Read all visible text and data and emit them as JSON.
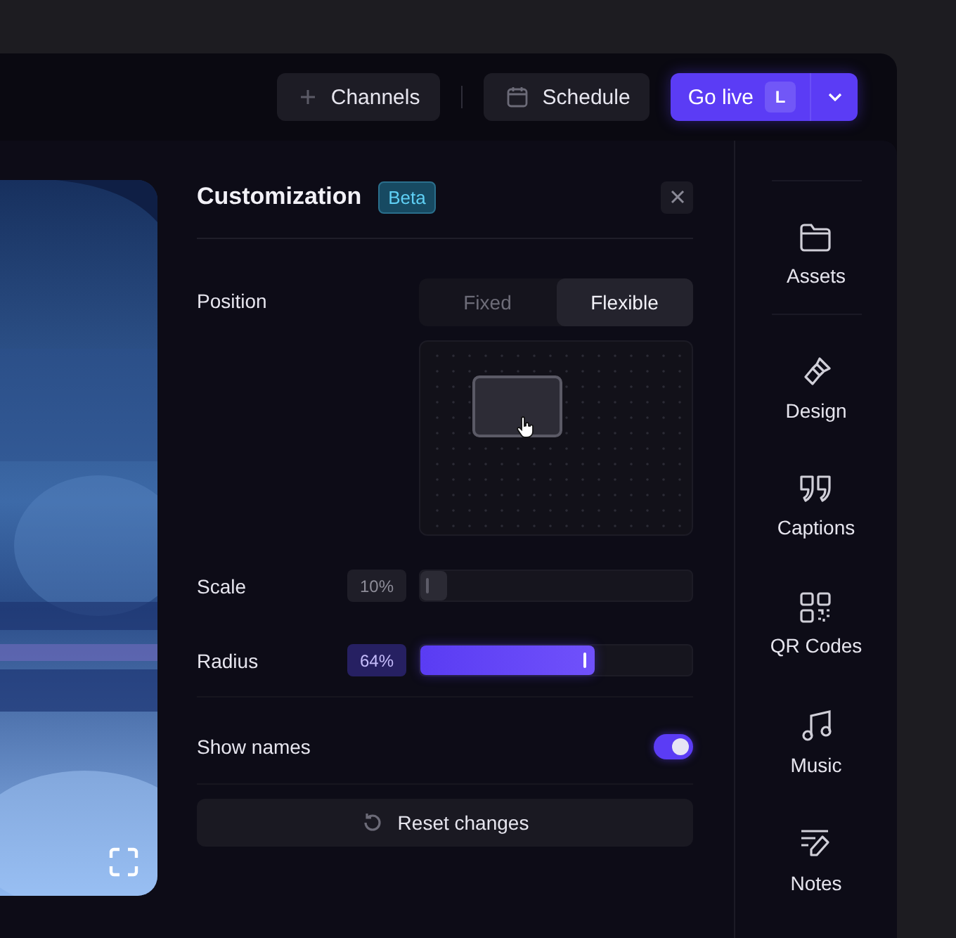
{
  "toolbar": {
    "buttons": [
      {
        "label": "Channels",
        "kind": "add"
      },
      {
        "label": "Schedule",
        "kind": "calendar"
      }
    ],
    "go_live": {
      "label": "Go live",
      "shortcut": "L"
    }
  },
  "panel": {
    "title": "Customization",
    "badge": "Beta",
    "position": {
      "label": "Position",
      "options": [
        {
          "label": "Fixed",
          "selected": false
        },
        {
          "label": "Flexible",
          "selected": true
        }
      ]
    },
    "sliders": [
      {
        "label": "Scale",
        "reading": "10%",
        "level": 0.1,
        "active": false
      },
      {
        "label": "Radius",
        "reading": "64%",
        "level": 0.64,
        "active": true
      }
    ],
    "show_names": {
      "label": "Show names",
      "on": true
    },
    "reset": "Reset changes"
  },
  "sidebar": {
    "items": [
      {
        "label": "Assets",
        "kind": "folder"
      },
      {
        "label": "Design",
        "kind": "brush"
      },
      {
        "label": "Captions",
        "kind": "quote"
      },
      {
        "label": "QR Codes",
        "kind": "qr"
      },
      {
        "label": "Music",
        "kind": "music"
      },
      {
        "label": "Notes",
        "kind": "notes"
      }
    ]
  }
}
